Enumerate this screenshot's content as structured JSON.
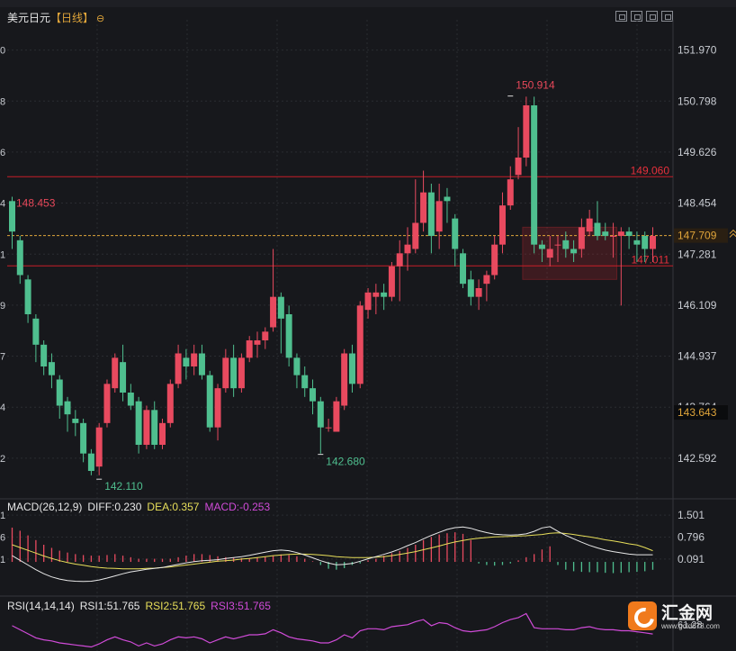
{
  "header": {
    "symbol": "美元日元",
    "period": "【日线】",
    "settings_icon": "settings-icon"
  },
  "colors": {
    "background": "#17181c",
    "up": "#e84a5f",
    "down": "#4fbf8f",
    "grid": "#2a2c31",
    "level_line": "#c81e28",
    "last_price_line": "#e0a53a",
    "diff": "#e8e8e8",
    "dea": "#e8df5a",
    "macd": "#d04bd8",
    "rsi": "#d04bd8"
  },
  "chart_data": [
    {
      "type": "candlestick",
      "title": "美元日元",
      "period": "日线",
      "ylim": [
        141.7,
        152.5
      ],
      "y_ticks": [
        "151.970",
        "150.798",
        "149.626",
        "148.454",
        "147.281",
        "146.109",
        "144.937",
        "143.764",
        "142.592"
      ],
      "left_tick_fragments": [
        "0",
        "8",
        "6",
        "4",
        "1",
        "9",
        "7",
        "4",
        "2"
      ],
      "candles": [
        [
          148.5,
          147.8,
          148.6,
          147.4
        ],
        [
          147.6,
          146.8,
          147.7,
          146.6
        ],
        [
          146.7,
          145.9,
          146.8,
          145.7
        ],
        [
          145.8,
          145.2,
          145.9,
          144.8
        ],
        [
          145.2,
          144.7,
          145.3,
          144.5
        ],
        [
          144.8,
          144.5,
          145.0,
          144.2
        ],
        [
          144.4,
          143.8,
          144.5,
          143.5
        ],
        [
          143.9,
          143.6,
          144.0,
          143.2
        ],
        [
          143.5,
          143.4,
          143.7,
          143.1
        ],
        [
          143.4,
          142.7,
          143.5,
          142.5
        ],
        [
          142.7,
          142.3,
          142.8,
          142.2
        ],
        [
          142.4,
          143.3,
          143.4,
          142.2
        ],
        [
          143.4,
          144.3,
          144.4,
          143.3
        ],
        [
          144.2,
          144.9,
          145.0,
          144.1
        ],
        [
          144.8,
          144.1,
          145.2,
          143.9
        ],
        [
          144.1,
          143.8,
          144.3,
          143.7
        ],
        [
          143.9,
          142.9,
          144.0,
          142.7
        ],
        [
          142.9,
          143.7,
          143.8,
          142.8
        ],
        [
          143.7,
          142.9,
          143.9,
          142.8
        ],
        [
          142.9,
          143.4,
          143.5,
          142.8
        ],
        [
          143.4,
          144.3,
          144.4,
          143.3
        ],
        [
          144.3,
          145.0,
          145.2,
          144.2
        ],
        [
          144.9,
          144.7,
          145.1,
          144.4
        ],
        [
          144.7,
          145.0,
          145.2,
          144.5
        ],
        [
          145.0,
          144.5,
          145.2,
          144.4
        ],
        [
          144.5,
          143.3,
          144.6,
          143.2
        ],
        [
          143.3,
          144.2,
          144.3,
          143.0
        ],
        [
          144.2,
          144.9,
          145.1,
          144.1
        ],
        [
          144.9,
          144.2,
          145.2,
          144.0
        ],
        [
          144.2,
          144.9,
          145.0,
          144.1
        ],
        [
          144.9,
          145.3,
          145.4,
          144.8
        ],
        [
          145.2,
          145.3,
          145.5,
          144.9
        ],
        [
          145.3,
          145.5,
          145.6,
          145.1
        ],
        [
          145.6,
          146.3,
          147.4,
          145.5
        ],
        [
          146.3,
          145.8,
          146.4,
          145.0
        ],
        [
          145.9,
          144.9,
          146.1,
          144.7
        ],
        [
          144.9,
          144.5,
          145.0,
          144.2
        ],
        [
          144.5,
          144.2,
          144.7,
          144.0
        ],
        [
          144.2,
          143.9,
          144.4,
          143.6
        ],
        [
          143.9,
          143.3,
          144.0,
          142.7
        ],
        [
          143.3,
          143.3,
          143.5,
          143.2
        ],
        [
          143.2,
          143.9,
          144.0,
          143.2
        ],
        [
          143.8,
          145.0,
          145.1,
          143.7
        ],
        [
          145.0,
          144.3,
          145.2,
          144.1
        ],
        [
          144.3,
          146.1,
          146.2,
          144.2
        ],
        [
          146.0,
          146.4,
          146.5,
          145.8
        ],
        [
          146.3,
          146.4,
          146.6,
          145.9
        ],
        [
          146.4,
          146.3,
          146.6,
          146.0
        ],
        [
          146.3,
          147.0,
          147.1,
          146.2
        ],
        [
          147.0,
          147.3,
          147.6,
          146.2
        ],
        [
          147.3,
          147.5,
          147.9,
          146.9
        ],
        [
          147.4,
          148.0,
          149.0,
          147.3
        ],
        [
          148.0,
          148.7,
          149.2,
          147.8
        ],
        [
          148.7,
          147.7,
          148.9,
          147.3
        ],
        [
          147.8,
          148.5,
          148.9,
          147.4
        ],
        [
          148.6,
          148.5,
          148.8,
          148.0
        ],
        [
          148.1,
          147.4,
          148.2,
          147.0
        ],
        [
          147.3,
          146.6,
          147.4,
          146.5
        ],
        [
          146.7,
          146.3,
          146.9,
          146.1
        ],
        [
          146.3,
          146.5,
          146.7,
          146.0
        ],
        [
          146.6,
          146.8,
          146.9,
          146.2
        ],
        [
          146.8,
          147.5,
          147.7,
          146.7
        ],
        [
          147.5,
          148.4,
          148.7,
          147.3
        ],
        [
          148.4,
          149.0,
          149.3,
          148.3
        ],
        [
          149.1,
          149.5,
          150.2,
          149.0
        ],
        [
          149.5,
          150.7,
          150.9,
          149.3
        ],
        [
          150.7,
          147.5,
          150.9,
          147.3
        ],
        [
          147.5,
          147.4,
          147.6,
          147.1
        ],
        [
          147.2,
          147.4,
          147.7,
          147.0
        ],
        [
          147.5,
          147.5,
          147.7,
          147.1
        ],
        [
          147.6,
          147.4,
          147.8,
          147.2
        ],
        [
          147.4,
          147.3,
          147.6,
          147.1
        ],
        [
          147.4,
          147.9,
          148.1,
          147.2
        ],
        [
          147.8,
          148.1,
          148.3,
          147.7
        ],
        [
          148.0,
          147.7,
          148.5,
          147.6
        ],
        [
          147.8,
          147.7,
          148.0,
          147.6
        ],
        [
          147.7,
          147.7,
          148.0,
          147.2
        ],
        [
          147.7,
          147.8,
          147.9,
          146.1
        ],
        [
          147.8,
          147.7,
          147.9,
          147.4
        ],
        [
          147.6,
          147.5,
          147.8,
          147.1
        ],
        [
          147.7,
          147.4,
          147.8,
          147.1
        ],
        [
          147.4,
          147.7,
          147.9,
          147.1
        ]
      ],
      "horizontal_lines": [
        {
          "value": 149.06,
          "label": "149.060"
        },
        {
          "value": 147.011,
          "label": "147.011"
        }
      ],
      "last_price": {
        "value": 147.709,
        "label": "147.709"
      },
      "hover_price": {
        "value": 143.643,
        "label": "143.643"
      },
      "shaded_range": {
        "from_index": 65,
        "to_index": 76,
        "low": 146.7,
        "high": 147.9
      },
      "annotations": [
        {
          "label": "148.453",
          "index": 0,
          "value": 148.453,
          "kind": "high"
        },
        {
          "label": "142.110",
          "index": 11,
          "value": 142.11,
          "kind": "low"
        },
        {
          "label": "142.680",
          "index": 39,
          "value": 142.68,
          "kind": "low"
        },
        {
          "label": "150.914",
          "index": 63,
          "value": 150.914,
          "kind": "high"
        }
      ]
    },
    {
      "type": "macd",
      "params_label": "MACD(26,12,9)",
      "diff_label": "DIFF:0.230",
      "dea_label": "DEA:0.357",
      "macd_label": "MACD:-0.253",
      "ylim": [
        -0.75,
        1.85
      ],
      "y_ticks": [
        "1.501",
        "0.796",
        "0.091"
      ],
      "left_tick_fragments": [
        "1",
        "6",
        "1"
      ],
      "diff": [
        0.2,
        0.05,
        -0.1,
        -0.25,
        -0.38,
        -0.48,
        -0.55,
        -0.6,
        -0.62,
        -0.63,
        -0.62,
        -0.58,
        -0.52,
        -0.45,
        -0.38,
        -0.32,
        -0.28,
        -0.24,
        -0.21,
        -0.18,
        -0.13,
        -0.08,
        -0.03,
        0.01,
        0.04,
        0.05,
        0.07,
        0.11,
        0.14,
        0.17,
        0.21,
        0.26,
        0.31,
        0.36,
        0.38,
        0.36,
        0.3,
        0.22,
        0.13,
        0.04,
        -0.04,
        -0.09,
        -0.08,
        -0.05,
        0.02,
        0.1,
        0.17,
        0.24,
        0.32,
        0.41,
        0.52,
        0.62,
        0.74,
        0.85,
        0.95,
        1.04,
        1.1,
        1.12,
        1.08,
        1.0,
        0.94,
        0.89,
        0.87,
        0.86,
        0.87,
        0.9,
        0.98,
        1.09,
        1.13,
        0.98,
        0.85,
        0.74,
        0.63,
        0.53,
        0.45,
        0.38,
        0.33,
        0.29,
        0.25,
        0.23,
        0.23,
        0.23
      ],
      "dea": [
        0.55,
        0.46,
        0.37,
        0.28,
        0.19,
        0.11,
        0.04,
        -0.02,
        -0.07,
        -0.11,
        -0.15,
        -0.18,
        -0.2,
        -0.21,
        -0.22,
        -0.22,
        -0.22,
        -0.21,
        -0.2,
        -0.18,
        -0.16,
        -0.13,
        -0.1,
        -0.07,
        -0.04,
        -0.01,
        0.02,
        0.04,
        0.06,
        0.09,
        0.11,
        0.14,
        0.17,
        0.2,
        0.22,
        0.24,
        0.25,
        0.25,
        0.24,
        0.22,
        0.2,
        0.17,
        0.15,
        0.14,
        0.14,
        0.14,
        0.15,
        0.17,
        0.2,
        0.24,
        0.28,
        0.33,
        0.39,
        0.45,
        0.51,
        0.58,
        0.64,
        0.69,
        0.73,
        0.76,
        0.78,
        0.8,
        0.81,
        0.82,
        0.83,
        0.84,
        0.86,
        0.88,
        0.92,
        0.93,
        0.91,
        0.88,
        0.84,
        0.8,
        0.76,
        0.71,
        0.67,
        0.63,
        0.58,
        0.54,
        0.46,
        0.36
      ],
      "macd": [
        1.1,
        1.0,
        0.85,
        0.7,
        0.55,
        0.45,
        0.36,
        0.3,
        0.25,
        0.22,
        0.2,
        0.2,
        0.22,
        0.25,
        0.2,
        0.15,
        0.1,
        0.1,
        0.1,
        0.1,
        0.1,
        0.15,
        0.2,
        0.25,
        0.25,
        0.22,
        0.18,
        0.15,
        0.13,
        0.12,
        0.12,
        0.14,
        0.16,
        0.2,
        0.24,
        0.22,
        0.18,
        0.1,
        0.02,
        -0.1,
        -0.22,
        -0.25,
        -0.2,
        -0.1,
        -0.05,
        0.05,
        0.1,
        0.2,
        0.28,
        0.35,
        0.45,
        0.55,
        0.7,
        0.8,
        0.88,
        0.92,
        0.95,
        0.9,
        0.7,
        -0.05,
        -0.1,
        -0.12,
        -0.1,
        -0.05,
        0.05,
        0.15,
        0.25,
        0.4,
        0.5,
        -0.1,
        -0.25,
        -0.3,
        -0.32,
        -0.33,
        -0.33,
        -0.35,
        -0.36,
        -0.35,
        -0.33,
        -0.32,
        -0.3,
        -0.253
      ]
    },
    {
      "type": "rsi",
      "params_label": "RSI(14,14,14)",
      "rsi1_label": "RSI1:51.765",
      "rsi2_label": "RSI2:51.765",
      "rsi3_label": "RSI3:51.765",
      "y_tick": "61.28",
      "ylim": [
        35,
        75
      ],
      "rsi": [
        60,
        56,
        52,
        48,
        46,
        45,
        43,
        42,
        41,
        40,
        39,
        42,
        46,
        49,
        46,
        44,
        40,
        43,
        40,
        42,
        46,
        49,
        48,
        49,
        47,
        43,
        46,
        49,
        47,
        49,
        51,
        51,
        52,
        56,
        53,
        49,
        47,
        46,
        45,
        43,
        43,
        46,
        51,
        48,
        55,
        57,
        57,
        56,
        59,
        60,
        61,
        64,
        66,
        60,
        63,
        62,
        58,
        55,
        54,
        55,
        56,
        59,
        63,
        66,
        68,
        72,
        58,
        57,
        57,
        57,
        56,
        56,
        58,
        59,
        57,
        56,
        56,
        55,
        55,
        54,
        53,
        51.765
      ]
    }
  ],
  "logo": {
    "name": "汇金网",
    "site": "www.gold678.com",
    "icon": "gold678-logo-icon"
  }
}
